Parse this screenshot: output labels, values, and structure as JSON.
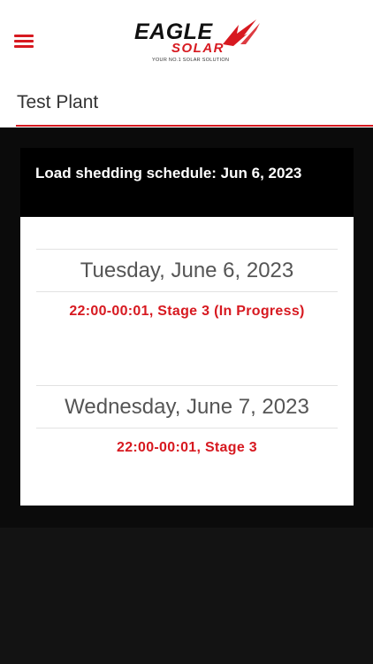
{
  "header": {
    "menu_icon": "hamburger-menu-icon",
    "logo": {
      "brand_line1": "EAGLE",
      "brand_line2": "SOLAR",
      "tagline": "YOUR NO.1 SOLAR SOLUTION"
    }
  },
  "plant": {
    "name": "Test Plant"
  },
  "schedule": {
    "title": "Load shedding schedule: Jun 6, 2023",
    "days": [
      {
        "date": "Tuesday, June 6, 2023",
        "slot": "22:00-00:01, Stage 3 (In Progress)"
      },
      {
        "date": "Wednesday, June 7, 2023",
        "slot": "22:00-00:01, Stage 3"
      }
    ]
  },
  "colors": {
    "accent": "#d71920",
    "header_bg": "#000000",
    "page_bg": "#0b0b0b",
    "card_bg": "#ffffff"
  }
}
